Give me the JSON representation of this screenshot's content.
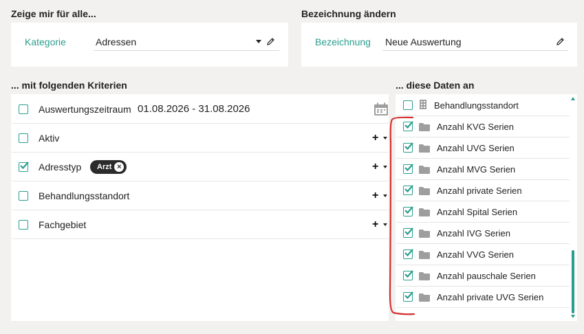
{
  "top_left": {
    "title": "Zeige mir für alle...",
    "category_label": "Kategorie",
    "category_value": "Adressen"
  },
  "top_right": {
    "title": "Bezeichnung ändern",
    "name_label": "Bezeichnung",
    "name_value": "Neue Auswertung"
  },
  "criteria": {
    "title": "... mit folgenden Kriterien",
    "rows": [
      {
        "label": "Auswertungszeitraum",
        "value": "01.08.2026 - 31.08.2026",
        "checked": false
      },
      {
        "label": "Aktiv",
        "checked": false
      },
      {
        "label": "Adresstyp",
        "chip": "Arzt",
        "checked": true
      },
      {
        "label": "Behandlungsstandort",
        "checked": false
      },
      {
        "label": "Fachgebiet",
        "checked": false
      }
    ]
  },
  "data": {
    "title": "... diese Daten an",
    "rows": [
      {
        "label": "Behandlungsstandort",
        "checked": false,
        "icon": "building-icon"
      },
      {
        "label": "Anzahl KVG Serien",
        "checked": true,
        "icon": "folder-icon"
      },
      {
        "label": "Anzahl UVG Serien",
        "checked": true,
        "icon": "folder-icon"
      },
      {
        "label": "Anzahl MVG Serien",
        "checked": true,
        "icon": "folder-icon"
      },
      {
        "label": "Anzahl private Serien",
        "checked": true,
        "icon": "folder-icon"
      },
      {
        "label": "Anzahl Spital Serien",
        "checked": true,
        "icon": "folder-icon"
      },
      {
        "label": "Anzahl IVG Serien",
        "checked": true,
        "icon": "folder-icon"
      },
      {
        "label": "Anzahl VVG Serien",
        "checked": true,
        "icon": "folder-icon"
      },
      {
        "label": "Anzahl pauschale Serien",
        "checked": true,
        "icon": "folder-icon"
      },
      {
        "label": "Anzahl private UVG Serien",
        "checked": true,
        "icon": "folder-icon"
      }
    ]
  },
  "colors": {
    "accent": "#2a9d8f",
    "annotation": "#d32f2f",
    "chip_bg": "#2b2b2b"
  }
}
